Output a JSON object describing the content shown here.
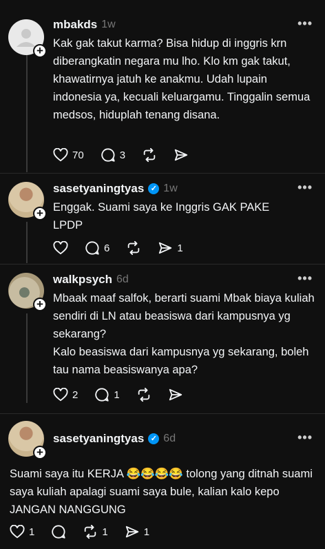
{
  "posts": [
    {
      "username": "mbakds",
      "time": "1w",
      "verified": false,
      "text": "Kak gak takut karma? Bisa hidup di inggris krn diberangkatin negara mu lho. Klo km gak takut, khawatirnya jatuh ke anakmu. Udah lupain indonesia ya, kecuali keluargamu. Tinggalin semua medsos, hiduplah tenang disana.",
      "likes": "70",
      "replies": "3",
      "reposts": "",
      "shares": ""
    },
    {
      "username": "sasetyaningtyas",
      "time": "1w",
      "verified": true,
      "text": "Enggak. Suami saya ke Inggris GAK PAKE LPDP",
      "likes": "",
      "replies": "6",
      "reposts": "",
      "shares": "1"
    },
    {
      "username": "walkpsych",
      "time": "6d",
      "verified": false,
      "text": "Mbaak maaf salfok, berarti suami Mbak biaya kuliah sendiri di LN atau beasiswa dari kampusnya yg sekarang?",
      "text2": "Kalo beasiswa dari kampusnya yg sekarang, boleh tau nama beasiswanya apa?",
      "likes": "2",
      "replies": "1",
      "reposts": "",
      "shares": ""
    },
    {
      "username": "sasetyaningtyas",
      "time": "6d",
      "verified": true,
      "text": "Suami saya itu KERJA 😂😂😂😂 tolong yang ditnah suami saya kuliah apalagi suami saya bule, kalian kalo kepo JANGAN NANGGUNG",
      "likes": "1",
      "replies": "",
      "reposts": "1",
      "shares": "1"
    }
  ],
  "icons": {
    "like": "heart-icon",
    "reply": "comment-icon",
    "repost": "repost-icon",
    "share": "share-icon",
    "more": "more-icon",
    "verified": "verified-badge-icon",
    "follow": "plus-icon"
  },
  "more_label": "•••",
  "verified_mark": "✓",
  "plus_mark": "+"
}
